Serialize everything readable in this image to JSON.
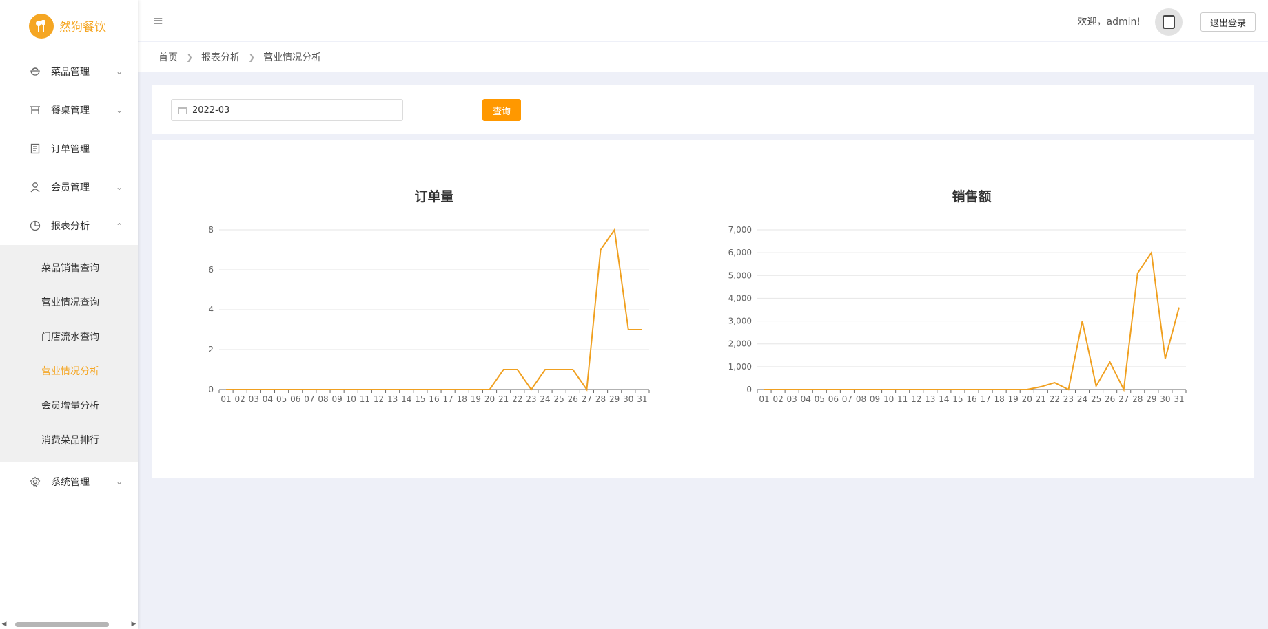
{
  "app": {
    "name": "然狗餐饮",
    "logo_icon": "utensils-icon"
  },
  "header": {
    "welcome": "欢迎，admin!",
    "logout_label": "退出登录"
  },
  "sidebar": {
    "items": [
      {
        "label": "菜品管理",
        "icon": "bowl-icon",
        "expandable": true
      },
      {
        "label": "餐桌管理",
        "icon": "table-icon",
        "expandable": true
      },
      {
        "label": "订单管理",
        "icon": "receipt-icon",
        "expandable": false
      },
      {
        "label": "会员管理",
        "icon": "user-icon",
        "expandable": true
      },
      {
        "label": "报表分析",
        "icon": "pie-chart-icon",
        "expandable": true,
        "expanded": true
      },
      {
        "label": "系统管理",
        "icon": "gear-icon",
        "expandable": true
      }
    ],
    "report_submenu": [
      {
        "label": "菜品销售查询"
      },
      {
        "label": "营业情况查询"
      },
      {
        "label": "门店流水查询"
      },
      {
        "label": "营业情况分析",
        "active": true
      },
      {
        "label": "会员增量分析"
      },
      {
        "label": "消费菜品排行"
      }
    ]
  },
  "breadcrumb": [
    "首页",
    "报表分析",
    "营业情况分析"
  ],
  "filter": {
    "month_value": "2022-03",
    "query_label": "查询"
  },
  "colors": {
    "accent": "#f5a623",
    "line": "#f0a020",
    "button": "#ff9800"
  },
  "chart_data": [
    {
      "type": "line",
      "title": "订单量",
      "x": [
        "01",
        "02",
        "03",
        "04",
        "05",
        "06",
        "07",
        "08",
        "09",
        "10",
        "11",
        "12",
        "13",
        "14",
        "15",
        "16",
        "17",
        "18",
        "19",
        "20",
        "21",
        "22",
        "23",
        "24",
        "25",
        "26",
        "27",
        "28",
        "29",
        "30",
        "31"
      ],
      "series": [
        {
          "values": [
            0,
            0,
            0,
            0,
            0,
            0,
            0,
            0,
            0,
            0,
            0,
            0,
            0,
            0,
            0,
            0,
            0,
            0,
            0,
            0,
            1,
            1,
            0,
            1,
            1,
            1,
            0,
            7,
            8,
            3,
            3
          ]
        }
      ],
      "ylim": [
        0,
        8
      ],
      "yticks": [
        "0",
        "2",
        "4",
        "6",
        "8"
      ],
      "grid": true
    },
    {
      "type": "line",
      "title": "销售额",
      "x": [
        "01",
        "02",
        "03",
        "04",
        "05",
        "06",
        "07",
        "08",
        "09",
        "10",
        "11",
        "12",
        "13",
        "14",
        "15",
        "16",
        "17",
        "18",
        "19",
        "20",
        "21",
        "22",
        "23",
        "24",
        "25",
        "26",
        "27",
        "28",
        "29",
        "30",
        "31"
      ],
      "series": [
        {
          "values": [
            0,
            0,
            0,
            0,
            0,
            0,
            0,
            0,
            0,
            0,
            0,
            0,
            0,
            0,
            0,
            0,
            0,
            0,
            0,
            0,
            120,
            300,
            0,
            3000,
            150,
            1200,
            0,
            5100,
            6000,
            1350,
            3600
          ]
        }
      ],
      "ylim": [
        0,
        7000
      ],
      "yticks": [
        "0",
        "1,000",
        "2,000",
        "3,000",
        "4,000",
        "5,000",
        "6,000",
        "7,000"
      ],
      "grid": true
    }
  ]
}
